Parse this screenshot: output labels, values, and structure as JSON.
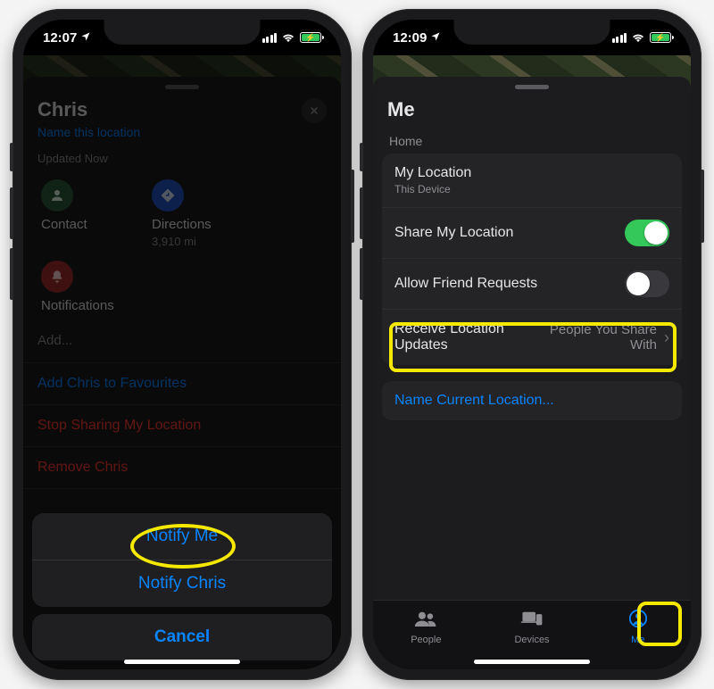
{
  "left": {
    "status_time": "12:07",
    "person_name": "Chris",
    "name_location_link": "Name this location",
    "updated_text": "Updated Now",
    "contact_label": "Contact",
    "directions_label": "Directions",
    "directions_distance": "3,910 mi",
    "notifications_label": "Notifications",
    "add_label": "Add...",
    "favourite_row": "Add Chris to Favourites",
    "stop_sharing_row": "Stop Sharing My Location",
    "remove_row": "Remove Chris",
    "sheet_notify_me": "Notify Me",
    "sheet_notify_friend": "Notify Chris",
    "sheet_cancel": "Cancel"
  },
  "right": {
    "status_time": "12:09",
    "title": "Me",
    "section_label": "Home",
    "my_location_label": "My Location",
    "my_location_value": "This Device",
    "share_location_label": "Share My Location",
    "share_location_on": true,
    "allow_requests_label": "Allow Friend Requests",
    "allow_requests_on": false,
    "receive_updates_label": "Receive Location Updates",
    "receive_updates_value": "People You Share With",
    "name_current_location": "Name Current Location...",
    "tabs": {
      "people": "People",
      "devices": "Devices",
      "me": "Me"
    }
  }
}
